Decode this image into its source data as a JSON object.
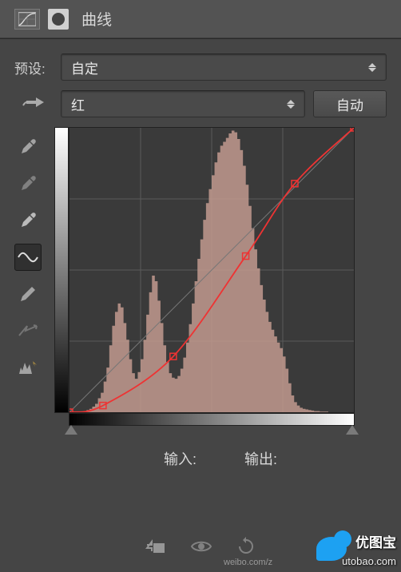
{
  "header": {
    "title": "曲线"
  },
  "preset": {
    "label": "预设:",
    "value": "自定"
  },
  "channel": {
    "value": "红",
    "auto_label": "自动"
  },
  "io": {
    "input_label": "输入:",
    "output_label": "输出:"
  },
  "watermark": {
    "line1": "优图宝",
    "line2": "utobao.com",
    "weibo": "weibo.com/z"
  },
  "chart_data": {
    "type": "curve_histogram",
    "title": "曲线 - 红",
    "xlabel": "输入",
    "ylabel": "输出",
    "xlim": [
      0,
      255
    ],
    "ylim": [
      0,
      255
    ],
    "grid": [
      4,
      4
    ],
    "curve_points": [
      {
        "x": 0,
        "y": 0
      },
      {
        "x": 30,
        "y": 6
      },
      {
        "x": 93,
        "y": 50
      },
      {
        "x": 158,
        "y": 140
      },
      {
        "x": 202,
        "y": 205
      },
      {
        "x": 255,
        "y": 255
      }
    ],
    "histogram": [
      0,
      0,
      0,
      0,
      0,
      2,
      4,
      6,
      10,
      15,
      25,
      35,
      55,
      80,
      120,
      155,
      180,
      195,
      188,
      160,
      130,
      95,
      70,
      60,
      72,
      95,
      130,
      175,
      215,
      245,
      235,
      200,
      160,
      120,
      90,
      70,
      62,
      60,
      65,
      78,
      98,
      125,
      158,
      195,
      235,
      275,
      310,
      345,
      375,
      400,
      425,
      448,
      466,
      478,
      485,
      492,
      500,
      505,
      502,
      490,
      470,
      442,
      408,
      370,
      330,
      292,
      258,
      228,
      202,
      180,
      162,
      148,
      136,
      125,
      115,
      100,
      78,
      52,
      30,
      18,
      12,
      8,
      6,
      5,
      4,
      3,
      2,
      2,
      1,
      1,
      1,
      0,
      0,
      0,
      0,
      0,
      0,
      0,
      0,
      0
    ],
    "histogram_max": 510,
    "curve_color": "#e33",
    "histogram_color": "#c29a8f"
  }
}
